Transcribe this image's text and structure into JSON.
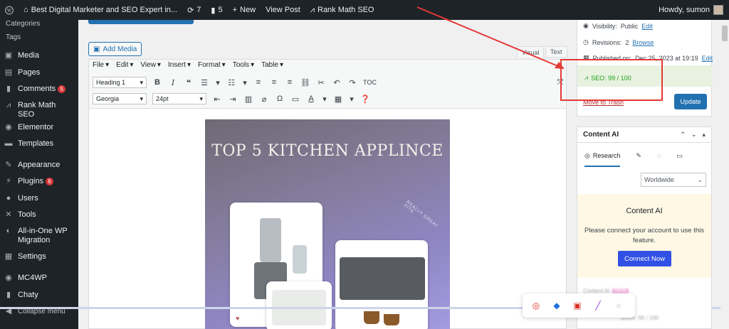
{
  "admin_bar": {
    "site_name": "Best Digital Marketer and SEO Expert in...",
    "updates_count": "7",
    "comments_count": "5",
    "new_label": "New",
    "view_post_label": "View Post",
    "rank_math_label": "Rank Math SEO",
    "howdy": "Howdy, sumon"
  },
  "sidebar": {
    "sub_categories": "Categories",
    "sub_tags": "Tags",
    "media": "Media",
    "pages": "Pages",
    "comments": "Comments",
    "comments_badge": "5",
    "rank_math": "Rank Math SEO",
    "elementor": "Elementor",
    "templates": "Templates",
    "appearance": "Appearance",
    "plugins": "Plugins",
    "plugins_badge": "6",
    "users": "Users",
    "tools": "Tools",
    "aio_line1": "All-in-One WP",
    "aio_line2": "Migration",
    "settings": "Settings",
    "mc4wp": "MC4WP",
    "chaty": "Chaty",
    "collapse": "Collapse menu"
  },
  "editor": {
    "add_media": "Add Media",
    "tab_visual": "Visual",
    "tab_text": "Text",
    "menus": [
      "File",
      "Edit",
      "View",
      "Insert",
      "Format",
      "Tools",
      "Table"
    ],
    "format_select": "Heading 1",
    "font_select": "Georgia",
    "size_select": "24pt",
    "toc_label": "TOC"
  },
  "post_image": {
    "title": "TOP 5 KITCHEN APPLINCE",
    "stamp": "REALLY GREAT SITE"
  },
  "publish": {
    "visibility_label": "Visibility:",
    "visibility_value": "Public",
    "visibility_edit": "Edit",
    "revisions_label": "Revisions:",
    "revisions_count": "2",
    "revisions_browse": "Browse",
    "published_label": "Published on:",
    "published_date": "Dec 25, 2023 at 19:19",
    "published_edit": "Edit",
    "seo_score": "SEO: 99 / 100",
    "move_to_trash": "Move to Trash",
    "update": "Update"
  },
  "content_ai": {
    "title": "Content AI",
    "tab_research": "Research",
    "region_select": "Worldwide",
    "connect_title": "Content AI",
    "connect_desc": "Please connect your account to use this feature.",
    "connect_button": "Connect Now",
    "blur_label": "Content AI",
    "blur_tag": "NEW",
    "blur_score": "Score: 66 / 100"
  },
  "colors": {
    "admin_dark": "#1d2327",
    "wp_blue": "#2271b1",
    "seo_green": "#25a016",
    "annotation_red": "#e53935",
    "connect_blue": "#3250e6"
  }
}
